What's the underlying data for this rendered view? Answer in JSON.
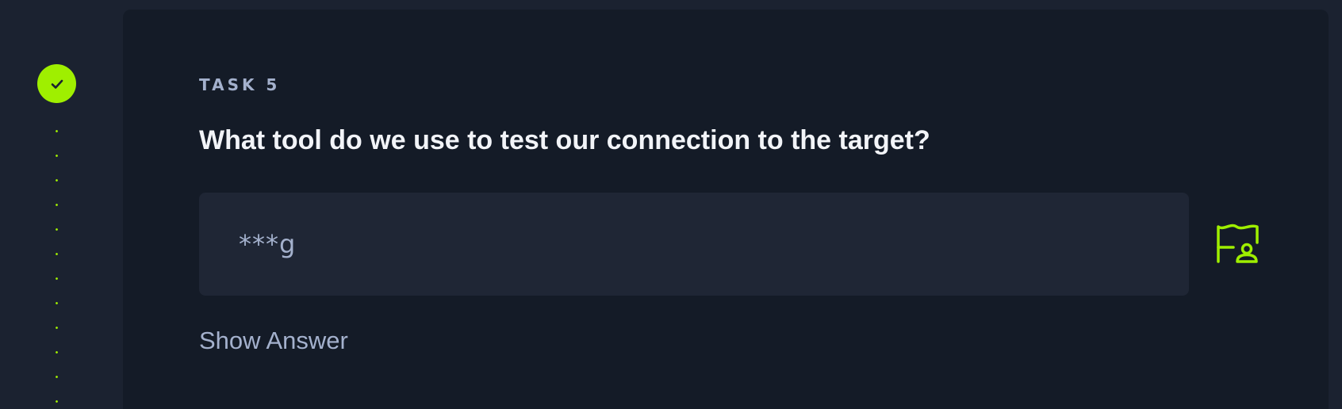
{
  "colors": {
    "accent": "#9fef00",
    "background": "#1b2230",
    "card": "#141b27",
    "input": "#1f2635",
    "muted_text": "#a4b1cd",
    "heading_text": "#f2f4f8"
  },
  "timeline": {
    "status_icon": "check-icon",
    "status": "completed"
  },
  "task": {
    "label": "TASK 5",
    "question": "What tool do we use to test our connection to the target?",
    "answer_value": "***g",
    "submit_icon": "flag-user-icon",
    "show_answer_label": "Show Answer"
  }
}
